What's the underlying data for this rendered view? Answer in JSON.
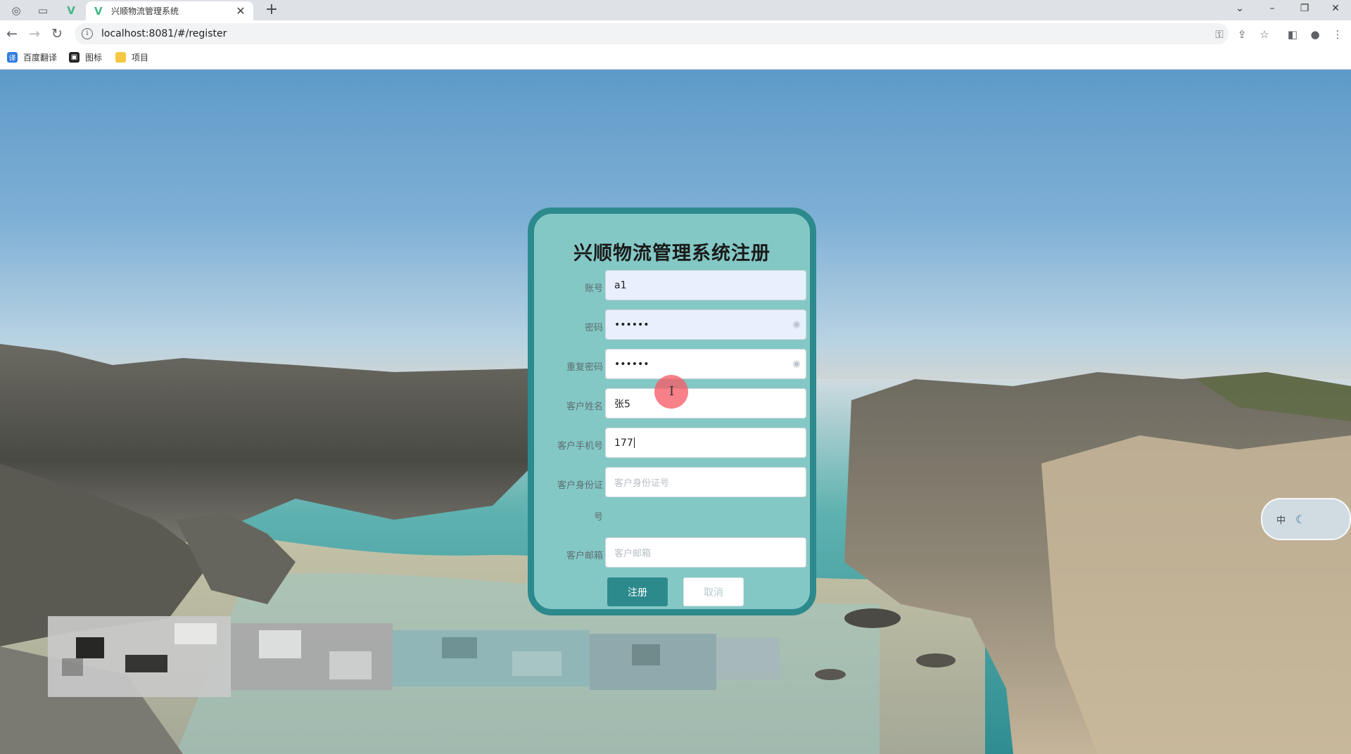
{
  "browser": {
    "tab_title": "兴顺物流管理系统",
    "url": "localhost:8081/#/register",
    "bookmarks": [
      {
        "label": "百度翻译",
        "icon": "translate-icon"
      },
      {
        "label": "图标",
        "icon": "picture-icon"
      },
      {
        "label": "项目",
        "icon": "folder-icon"
      }
    ]
  },
  "form": {
    "title": "兴顺物流管理系统注册",
    "fields": [
      {
        "label": "账号",
        "value": "a1",
        "placeholder": ""
      },
      {
        "label": "密码",
        "value": "••••••",
        "placeholder": ""
      },
      {
        "label": "重复密码",
        "value": "••••••",
        "placeholder": ""
      },
      {
        "label": "客户姓名",
        "value": "张5",
        "placeholder": ""
      },
      {
        "label": "客户手机号",
        "value": "177",
        "placeholder": ""
      },
      {
        "label_line1": "客户身份证",
        "label_line2": "号",
        "value": "",
        "placeholder": "客户身份证号"
      },
      {
        "label": "客户邮箱",
        "value": "",
        "placeholder": "客户邮箱"
      }
    ],
    "submit_label": "注册",
    "cancel_label": "取消"
  },
  "ime": {
    "mode": "中"
  },
  "colors": {
    "card_bg": "#84c8c6",
    "card_border": "#2c8a8d",
    "primary": "#2c8a8d"
  }
}
